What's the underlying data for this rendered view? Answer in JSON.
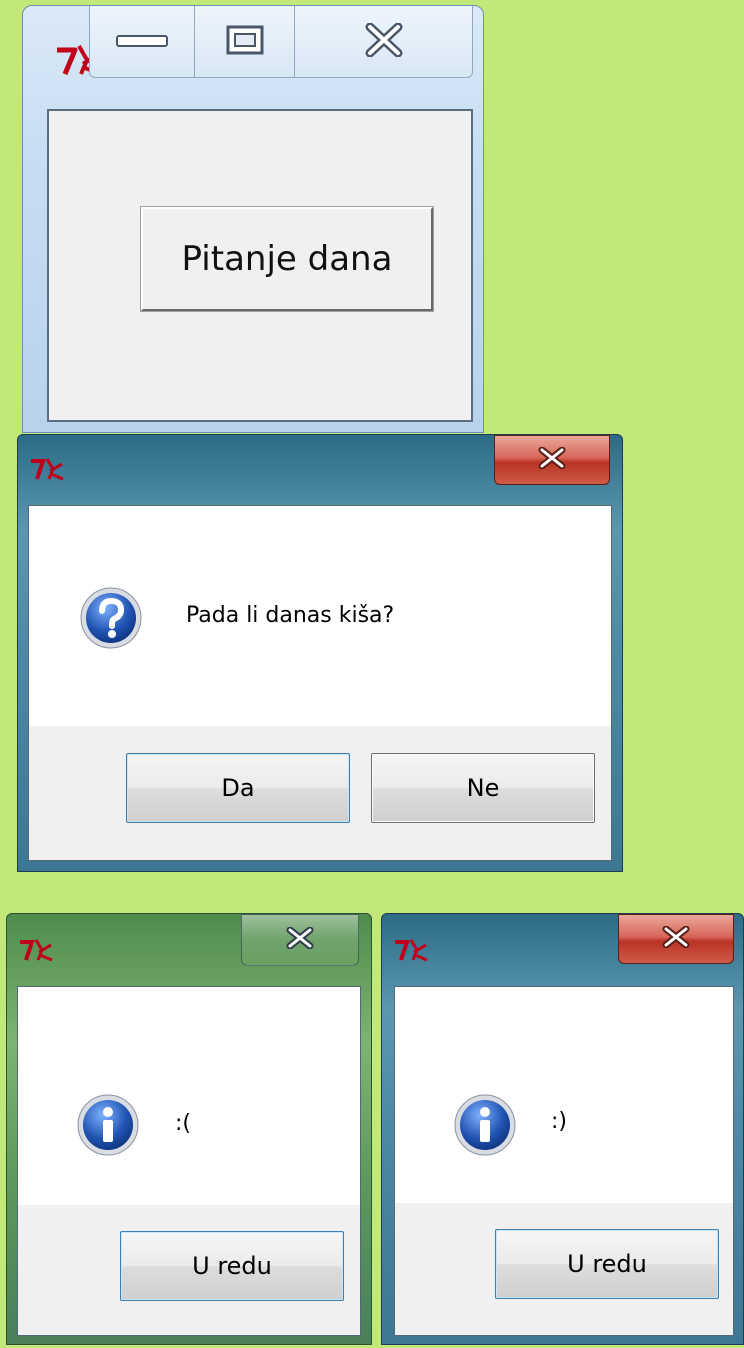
{
  "main_window": {
    "button_label": "Pitanje dana",
    "caption_buttons": [
      "minimize",
      "maximize",
      "close"
    ],
    "app_icon": "tk-feather-icon"
  },
  "question_dialog": {
    "message": "Pada li danas kiša?",
    "icon": "question-icon",
    "buttons": [
      "Da",
      "Ne"
    ]
  },
  "sad_dialog": {
    "message": ":(",
    "icon": "info-icon",
    "button_label": "U redu"
  },
  "happy_dialog": {
    "message": ":)",
    "icon": "info-icon",
    "button_label": "U redu"
  },
  "colors": {
    "background": "#c2e879",
    "close_button_red": "#c8473a",
    "icon_blue": "#1f52b0"
  }
}
